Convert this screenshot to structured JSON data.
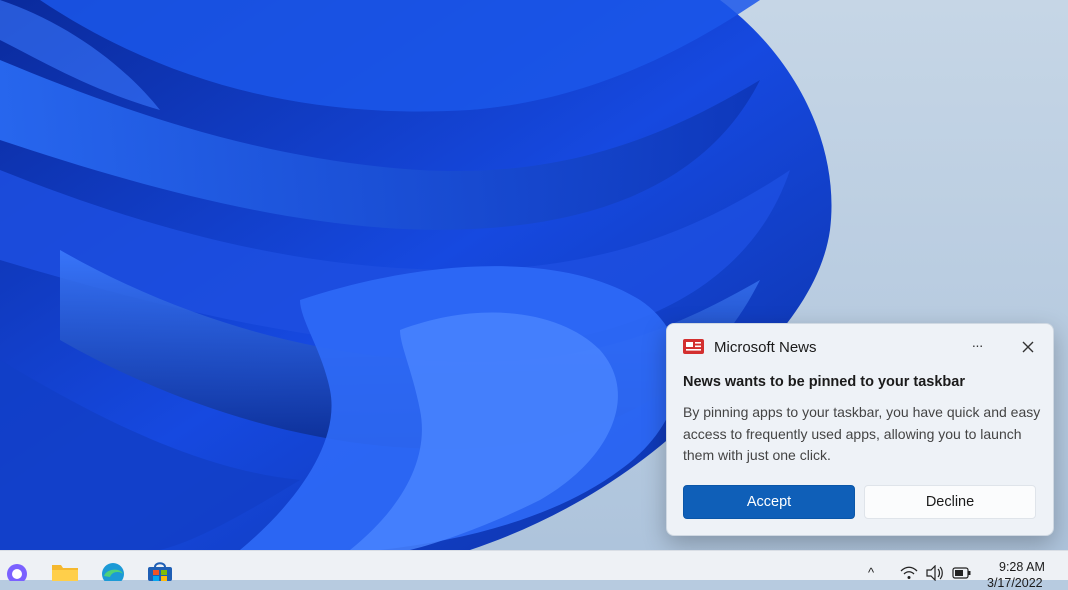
{
  "notification": {
    "app_name": "Microsoft News",
    "app_icon": "news-icon",
    "title": "News wants to be pinned to your taskbar",
    "body": "By pinning apps to your taskbar, you have quick and easy access to frequently used apps, allowing you to launch them with just one click.",
    "more_label": "···",
    "accept_label": "Accept",
    "decline_label": "Decline",
    "accent_color": "#0f5fb8"
  },
  "taskbar": {
    "apps": [
      {
        "name": "teams-chat-icon"
      },
      {
        "name": "file-explorer-icon"
      },
      {
        "name": "edge-browser-icon"
      },
      {
        "name": "microsoft-store-icon"
      }
    ],
    "tray": {
      "chevron": "^",
      "icons": [
        "wifi-icon",
        "volume-icon",
        "battery-icon"
      ]
    },
    "clock": {
      "time": "9:28 AM",
      "date": "3/17/2022"
    }
  }
}
